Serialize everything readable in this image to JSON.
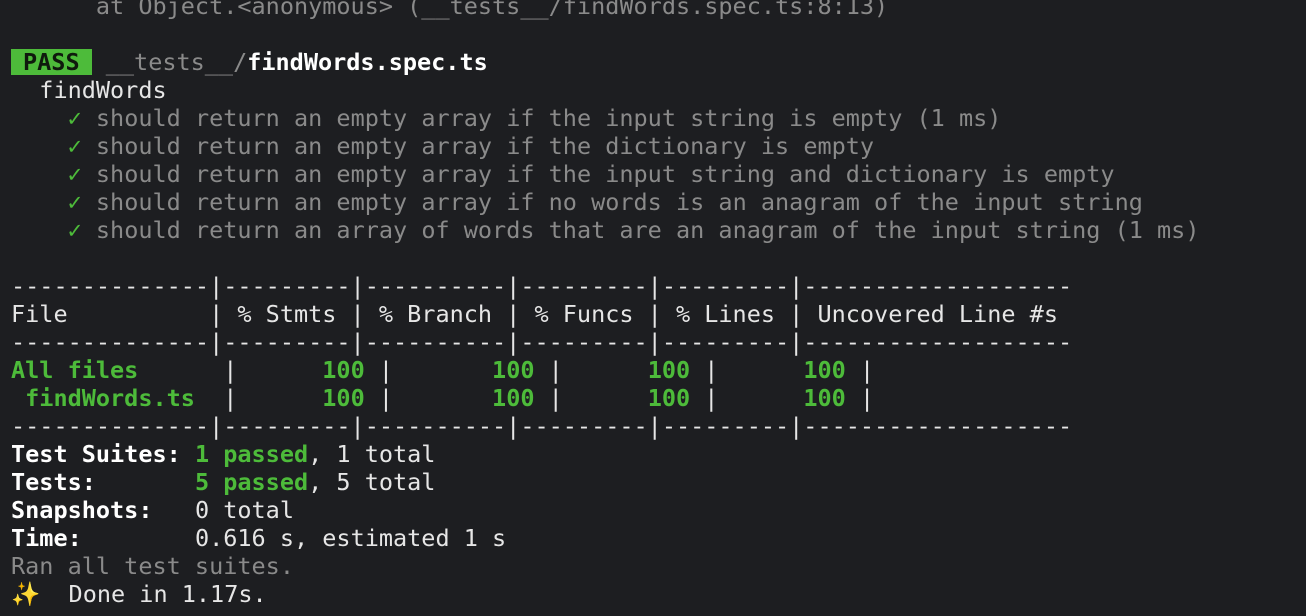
{
  "stack_trace": {
    "line": "      at Object.<anonymous> (__tests__/findWords.spec.ts:8:13)"
  },
  "result": {
    "badge": "PASS",
    "path_dir": "__tests__/",
    "path_file": "findWords.spec.ts"
  },
  "suite": {
    "name": "findWords",
    "check_mark": "✓",
    "tests": [
      {
        "text": "should return an empty array if the input string is empty",
        "time": " (1 ms)"
      },
      {
        "text": "should return an empty array if the dictionary is empty",
        "time": ""
      },
      {
        "text": "should return an empty array if the input string and dictionary is empty",
        "time": ""
      },
      {
        "text": "should return an empty array if no words is an anagram of the input string",
        "time": ""
      },
      {
        "text": "should return an array of words that are an anagram of the input string",
        "time": " (1 ms)"
      }
    ]
  },
  "coverage": {
    "separator": "--------------|---------|----------|---------|---------|-------------------",
    "header": "File          | % Stmts | % Branch | % Funcs | % Lines | Uncovered Line #s ",
    "rows": [
      {
        "file": "All files     ",
        "stmts": "     100",
        "branch": "      100",
        "funcs": "     100",
        "lines": "     100"
      },
      {
        "file": " findWords.ts ",
        "stmts": "     100",
        "branch": "      100",
        "funcs": "     100",
        "lines": "     100"
      }
    ],
    "pipe": " | ",
    "pipe_end": " | "
  },
  "summary": {
    "suites_label": "Test Suites:",
    "suites_passed": "1 passed",
    "suites_total": ", 1 total",
    "tests_label": "Tests:",
    "tests_passed": "5 passed",
    "tests_total": ", 5 total",
    "snapshots_label": "Snapshots:",
    "snapshots_value": "0 total",
    "time_label": "Time:",
    "time_value": "0.616 s, estimated 1 s",
    "ran_all": "Ran all test suites.",
    "done_icon": "✨",
    "done_text": "  Done in 1.17s."
  },
  "colors": {
    "background": "#1d1e21",
    "pass_green": "#4dbb3a",
    "dim_text": "#8a8a8a"
  }
}
